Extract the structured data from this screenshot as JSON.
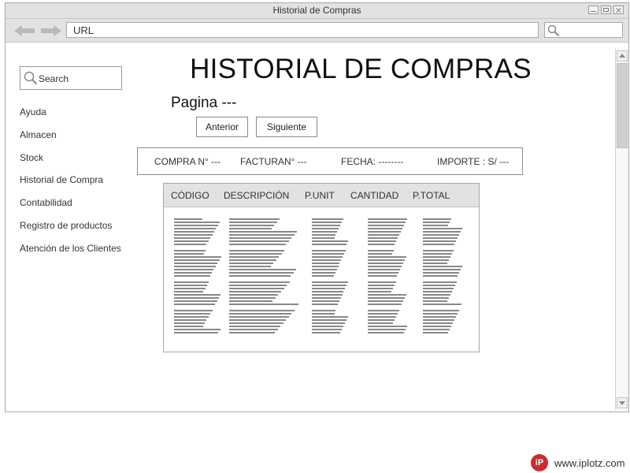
{
  "window": {
    "title": "Historial de Compras"
  },
  "browser": {
    "url": "URL"
  },
  "sidebar": {
    "search_label": "Search",
    "items": [
      {
        "label": "Ayuda"
      },
      {
        "label": "Almacen"
      },
      {
        "label": "Stock"
      },
      {
        "label": "Historial de Compra"
      },
      {
        "label": "Contabilidad"
      },
      {
        "label": "Registro de productos"
      },
      {
        "label": "Atención de los Clientes"
      }
    ]
  },
  "main": {
    "title": "HISTORIAL DE COMPRAS",
    "pagina": "Pagina ---",
    "buttons": {
      "prev": "Anterior",
      "next": "Siguiente"
    },
    "info": {
      "compra": "COMPRA N°  ---",
      "factura": "FACTURAN° ---",
      "fecha": "FECHA: --------",
      "importe": "IMPORTE : S/ ---"
    },
    "table": {
      "headers": [
        "CÓDIGO",
        "DESCRIPCIÓN",
        "P.UNIT",
        "CANTIDAD",
        "P.TOTAL"
      ]
    }
  },
  "footer": {
    "logo_text": "www.iplotz.com",
    "logo_mark": "iP"
  },
  "colors": {
    "chrome": "#e2e2e2",
    "border": "#a8a8a8",
    "logo": "#c82e2e"
  }
}
